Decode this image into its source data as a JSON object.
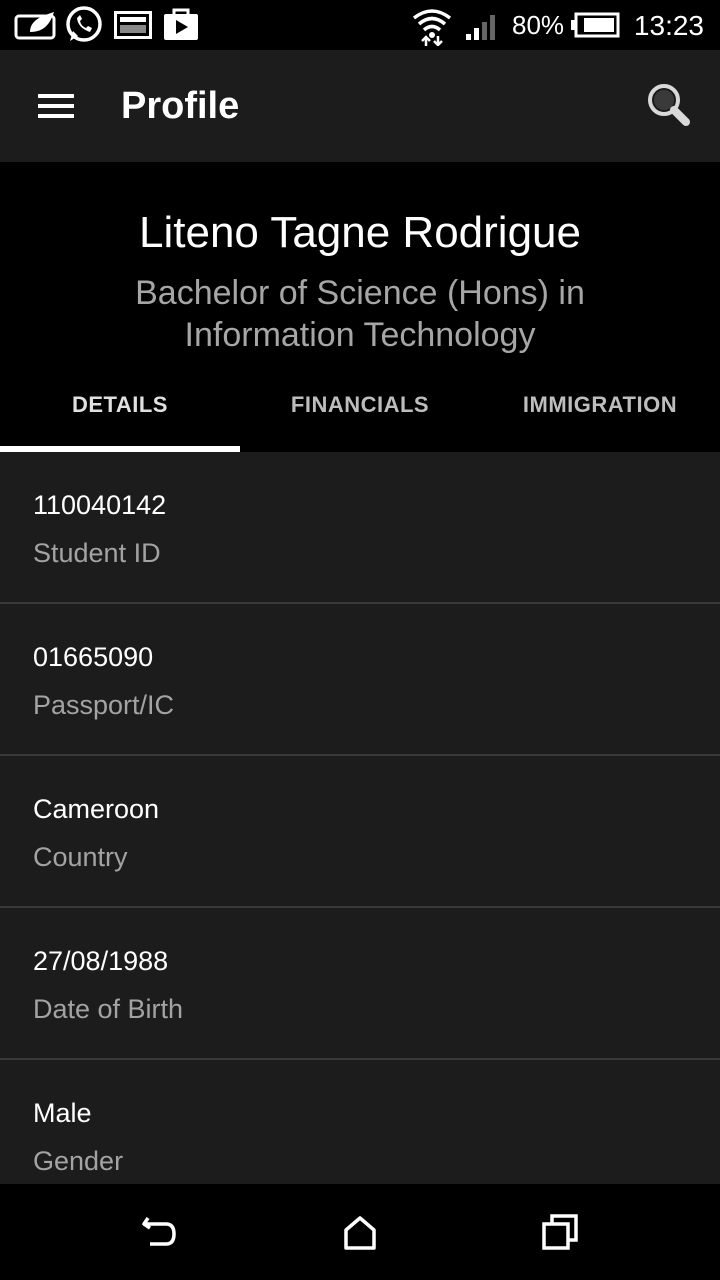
{
  "status_bar": {
    "battery": "80%",
    "time": "13:23",
    "icons": [
      "leaf-notification-icon",
      "whatsapp-icon",
      "image-icon",
      "play-store-icon",
      "wifi-icon",
      "signal-icon",
      "battery-icon"
    ]
  },
  "app_bar": {
    "title": "Profile",
    "menu_icon": "hamburger-menu-icon",
    "search_icon": "search-icon"
  },
  "profile": {
    "name": "Liteno Tagne Rodrigue",
    "degree": "Bachelor of Science (Hons) in Information Technology"
  },
  "tabs": [
    {
      "label": "DETAILS",
      "active": true
    },
    {
      "label": "FINANCIALS",
      "active": false
    },
    {
      "label": "IMMIGRATION",
      "active": false
    }
  ],
  "details": [
    {
      "value": "110040142",
      "label": "Student ID"
    },
    {
      "value": "01665090",
      "label": "Passport/IC"
    },
    {
      "value": "Cameroon",
      "label": "Country"
    },
    {
      "value": "27/08/1988",
      "label": "Date of Birth"
    },
    {
      "value": "Male",
      "label": "Gender"
    }
  ],
  "nav_bar": {
    "icons": [
      "back-icon",
      "home-icon",
      "recents-icon"
    ]
  },
  "colors": {
    "app_bar": "#1c1c1c",
    "header": "#000000",
    "list_bg": "#1c1c1c",
    "secondary_text": "#a3a3a3",
    "divider": "#3a3a3a"
  }
}
